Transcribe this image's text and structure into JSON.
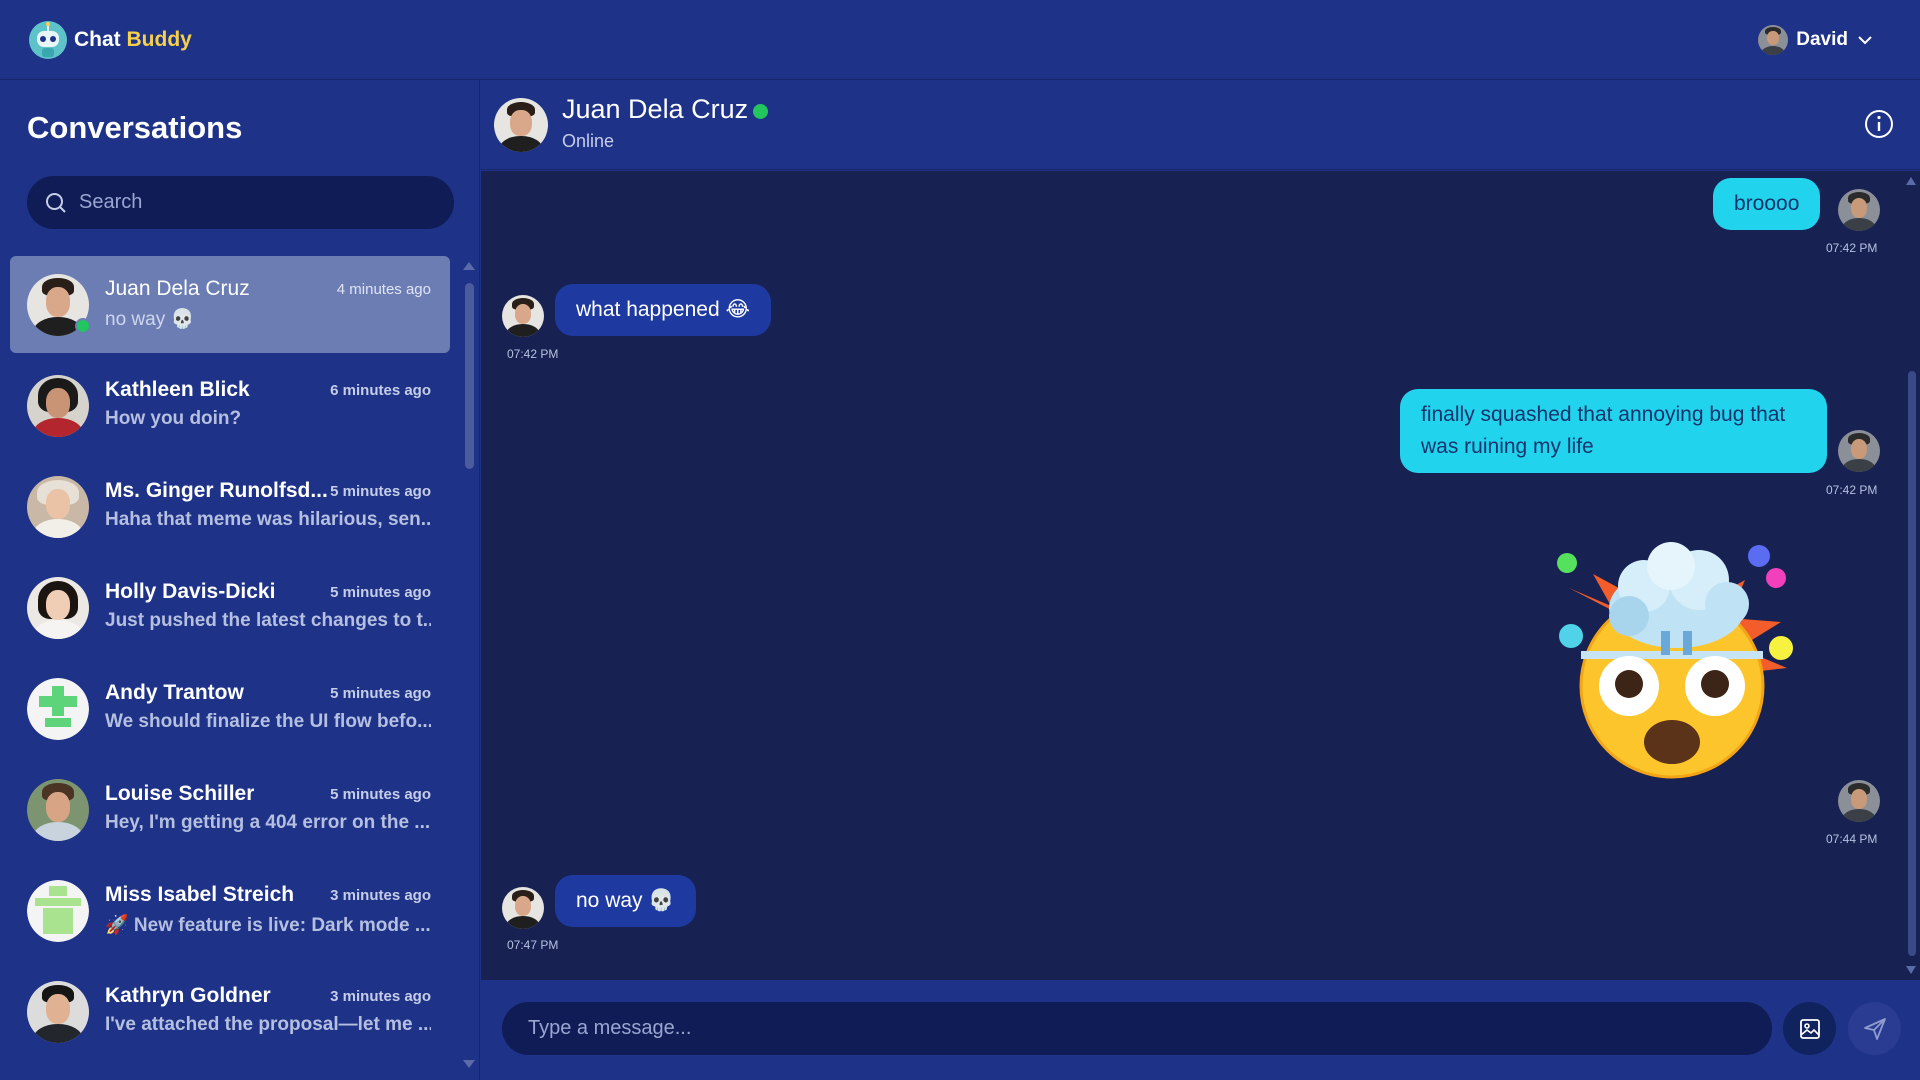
{
  "app": {
    "brand_part1": "Chat",
    "brand_part2": "Buddy"
  },
  "user": {
    "name": "David"
  },
  "sidebar": {
    "title": "Conversations",
    "search_placeholder": "Search",
    "conversations": [
      {
        "name": "Juan Dela Cruz",
        "time": "4 minutes ago",
        "preview": "no way 💀",
        "active": true,
        "online": true
      },
      {
        "name": "Kathleen Blick",
        "time": "6 minutes ago",
        "preview": "How you doin?"
      },
      {
        "name": "Ms. Ginger Runolfsd...",
        "time": "5 minutes ago",
        "preview": "Haha that meme was hilarious, sen..."
      },
      {
        "name": "Holly Davis-Dicki",
        "time": "5 minutes ago",
        "preview": "Just pushed the latest changes to t..."
      },
      {
        "name": "Andy Trantow",
        "time": "5 minutes ago",
        "preview": "We should finalize the UI flow befo..."
      },
      {
        "name": "Louise Schiller",
        "time": "5 minutes ago",
        "preview": "Hey, I'm getting a 404 error on the ..."
      },
      {
        "name": "Miss Isabel Streich",
        "time": "3 minutes ago",
        "preview": "🚀 New feature is live: Dark mode ..."
      },
      {
        "name": "Kathryn Goldner",
        "time": "3 minutes ago",
        "preview": "I've attached the proposal—let me ..."
      }
    ]
  },
  "chat": {
    "peer_name": "Juan Dela Cruz",
    "peer_status": "Online",
    "messages": [
      {
        "direction": "out",
        "text": "broooo",
        "time": "07:42 PM"
      },
      {
        "direction": "in",
        "text": "what happened 😂",
        "time": "07:42 PM"
      },
      {
        "direction": "out",
        "text": "finally squashed that annoying bug that was ruining my life",
        "time": "07:42 PM"
      },
      {
        "direction": "out",
        "sticker": "exploding-head-emoji",
        "time": "07:44 PM"
      },
      {
        "direction": "in",
        "text": "no way 💀",
        "time": "07:47 PM"
      }
    ],
    "composer_placeholder": "Type a message..."
  },
  "colors": {
    "background": "#1e3288",
    "messages_bg": "#172253",
    "incoming_bubble": "#1e3aa0",
    "outgoing_bubble": "#22d3ee",
    "online": "#22c55e",
    "brand_accent": "#f7d04a"
  }
}
